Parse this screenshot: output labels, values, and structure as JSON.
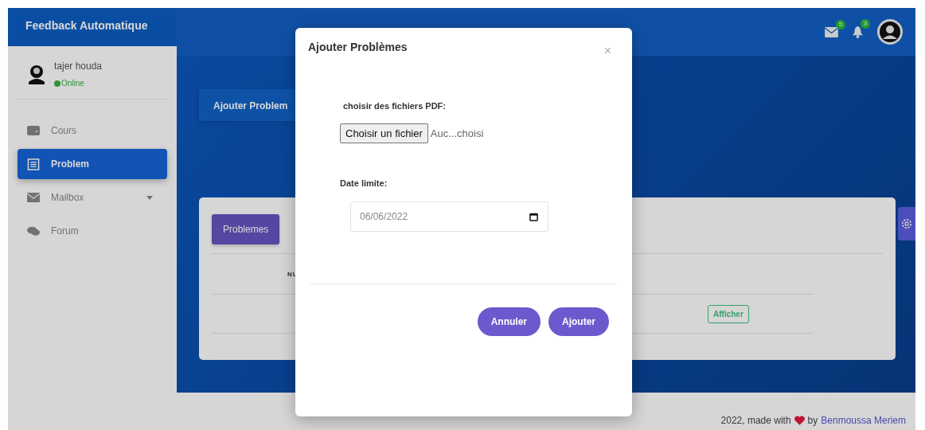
{
  "app": {
    "title": "Feedback Automatique"
  },
  "user": {
    "name": "tajer houda",
    "status": "Online",
    "online": true
  },
  "nav": [
    {
      "label": "Cours",
      "selected": false,
      "expandable": false
    },
    {
      "label": "Problem",
      "selected": true,
      "expandable": false
    },
    {
      "label": "Mailbox",
      "selected": false,
      "expandable": true
    },
    {
      "label": "Forum",
      "selected": false,
      "expandable": false
    }
  ],
  "topbar": {
    "mail_badge": "5",
    "notification_badge": "3"
  },
  "page_card": {
    "title": "Ajouter Problem"
  },
  "table_card": {
    "button": "Problemes",
    "columns": [
      "NU"
    ],
    "rows": [
      {
        "action": "Afficher"
      }
    ]
  },
  "modal": {
    "title": "Ajouter Problèmes",
    "close": "×",
    "file_label": "choisir des fichiers PDF:",
    "file_button": "Choisir un fichier",
    "file_status": "Auc...choisi",
    "date_label": "Date limite:",
    "date_value": "06/06/2022",
    "buttons": [
      "Annuler",
      "Ajouter"
    ]
  },
  "footer": {
    "text": "2022, made with",
    "by": "by",
    "author": "Benmoussa Meriem"
  }
}
